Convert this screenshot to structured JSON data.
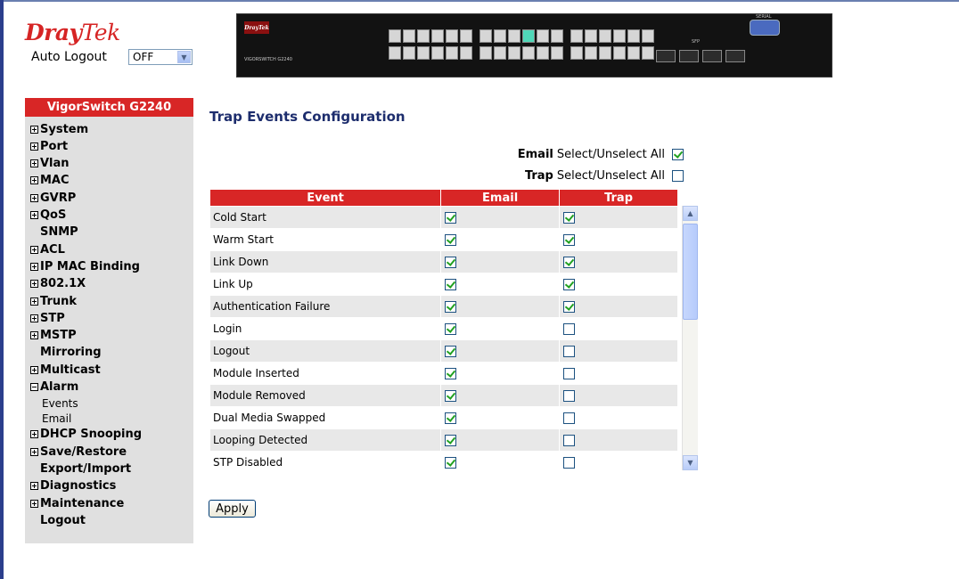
{
  "brand": {
    "name_bold": "Dray",
    "name_light": "Tek"
  },
  "auto_logout": {
    "label": "Auto Logout",
    "value": "OFF"
  },
  "device": {
    "logo": "DrayTek",
    "model": "VIGORSWITCH G2240",
    "serial_label": "SERIAL",
    "sfp_label": "SFP"
  },
  "sidebar": {
    "title": "VigorSwitch G2240",
    "items": [
      {
        "label": "System",
        "icon": "plus"
      },
      {
        "label": "Port",
        "icon": "plus"
      },
      {
        "label": "Vlan",
        "icon": "plus"
      },
      {
        "label": "MAC",
        "icon": "plus"
      },
      {
        "label": "GVRP",
        "icon": "plus"
      },
      {
        "label": "QoS",
        "icon": "plus"
      },
      {
        "label": "SNMP",
        "icon": "none"
      },
      {
        "label": "ACL",
        "icon": "plus"
      },
      {
        "label": "IP MAC Binding",
        "icon": "plus"
      },
      {
        "label": "802.1X",
        "icon": "plus"
      },
      {
        "label": "Trunk",
        "icon": "plus"
      },
      {
        "label": "STP",
        "icon": "plus"
      },
      {
        "label": "MSTP",
        "icon": "plus"
      },
      {
        "label": "Mirroring",
        "icon": "none"
      },
      {
        "label": "Multicast",
        "icon": "plus"
      },
      {
        "label": "Alarm",
        "icon": "minus"
      },
      {
        "label": "Events",
        "icon": "sub"
      },
      {
        "label": "Email",
        "icon": "sub"
      },
      {
        "label": "DHCP Snooping",
        "icon": "plus"
      },
      {
        "label": "Save/Restore",
        "icon": "plus"
      },
      {
        "label": "Export/Import",
        "icon": "none"
      },
      {
        "label": "Diagnostics",
        "icon": "plus"
      },
      {
        "label": "Maintenance",
        "icon": "plus"
      },
      {
        "label": "Logout",
        "icon": "none"
      }
    ]
  },
  "main": {
    "title": "Trap Events Configuration",
    "email_all": {
      "bold": "Email",
      "text": "Select/Unselect All",
      "checked": true
    },
    "trap_all": {
      "bold": "Trap",
      "text": "Select/Unselect All",
      "checked": false
    },
    "columns": [
      "Event",
      "Email",
      "Trap"
    ],
    "rows": [
      {
        "event": "Cold Start",
        "email": true,
        "trap": true
      },
      {
        "event": "Warm Start",
        "email": true,
        "trap": true
      },
      {
        "event": "Link Down",
        "email": true,
        "trap": true
      },
      {
        "event": "Link Up",
        "email": true,
        "trap": true
      },
      {
        "event": "Authentication Failure",
        "email": true,
        "trap": true
      },
      {
        "event": "Login",
        "email": true,
        "trap": false
      },
      {
        "event": "Logout",
        "email": true,
        "trap": false
      },
      {
        "event": "Module Inserted",
        "email": true,
        "trap": false
      },
      {
        "event": "Module Removed",
        "email": true,
        "trap": false
      },
      {
        "event": "Dual Media Swapped",
        "email": true,
        "trap": false
      },
      {
        "event": "Looping Detected",
        "email": true,
        "trap": false
      },
      {
        "event": "STP Disabled",
        "email": true,
        "trap": false
      }
    ],
    "apply_label": "Apply"
  }
}
